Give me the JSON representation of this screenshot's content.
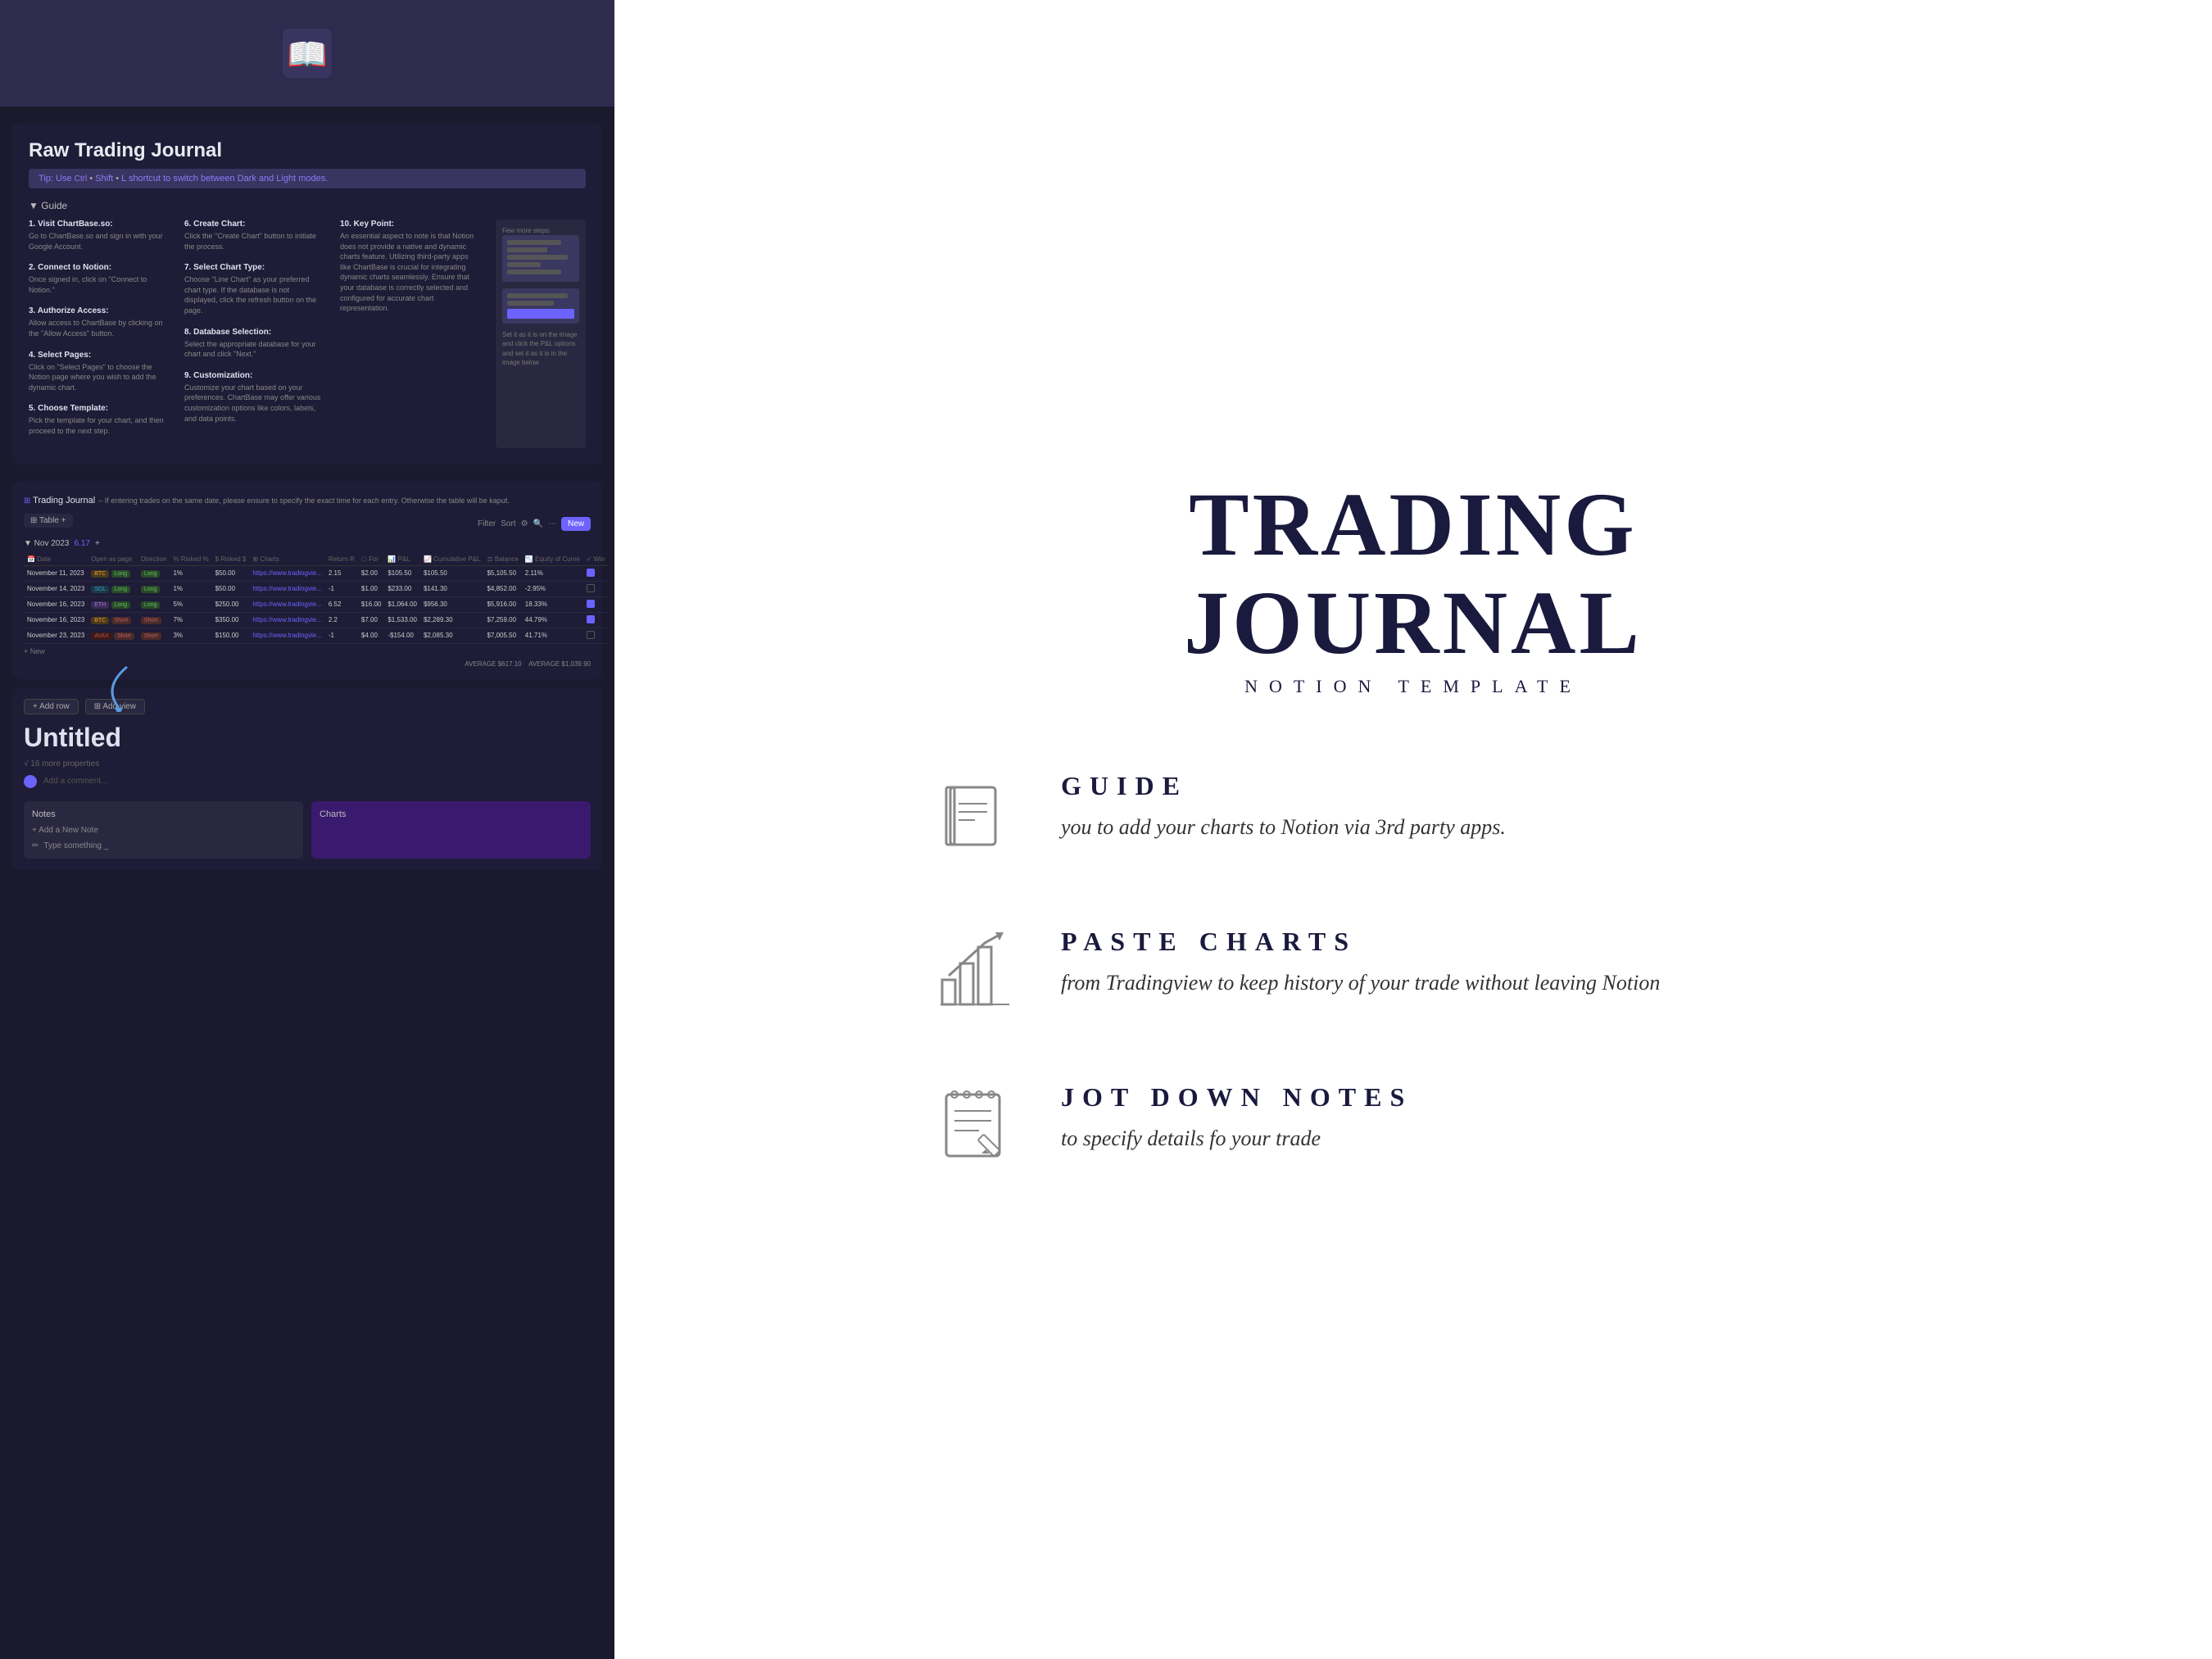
{
  "leftPanel": {
    "header": {
      "label": "header-area"
    },
    "guideSection": {
      "title": "Raw Trading Journal",
      "tipText": "Tip: Use ",
      "tipShortcut": "Ctrl + Shift + L",
      "tipEnd": " shortcut to switch between Dark and Light modes.",
      "guideLabel": "▼ Guide",
      "steps": [
        {
          "num": "1.",
          "title": "Visit ChartBase.so:",
          "text": "Go to ChartBase.so and sign in with your Google Account."
        },
        {
          "num": "2.",
          "title": "Connect to Notion:",
          "text": "Once signed in, click on \"Connect to Notion.\""
        },
        {
          "num": "3.",
          "title": "Authorize Access:",
          "text": "Allow access to ChartBase by clicking on the \"Allow Access\" button."
        },
        {
          "num": "4.",
          "title": "Select Pages:",
          "text": "Click on \"Select Pages\" to choose the Notion page where you wish to add the dynamic chart."
        },
        {
          "num": "5.",
          "title": "Choose Template:",
          "text": "Pick the template for your chart, and then proceed to the next step."
        }
      ],
      "stepsRight": [
        {
          "num": "6.",
          "title": "Create Chart:",
          "text": "Click the \"Create Chart\" button to initiate the process."
        },
        {
          "num": "7.",
          "title": "Select Chart Type:",
          "text": "Choose \"Line Chart\" as your preferred chart type. If the database is not displayed, click the refresh button on the page."
        },
        {
          "num": "8.",
          "title": "Database Selection:",
          "text": "Select the appropriate database for your chart and click \"Next.\""
        },
        {
          "num": "9.",
          "title": "Customization:",
          "text": "Customize your chart based on your preferences. ChartBase may offer various customization options like colors, labels, and data points."
        }
      ],
      "stepsMore": [
        {
          "num": "10.",
          "title": "Key Point:",
          "text": "An essential aspect to note is that Notion does not provide a native and dynamic charts feature. Utilizing third-party apps like ChartBase is crucial for integrating dynamic charts seamlessly. Ensure that your database is correctly selected and configured for accurate chart representation."
        }
      ],
      "fewMoreSteps": "Few more steps:",
      "screenshotCaption": "Set it as it is on the image and click the P&L options and set it as it is in the image below"
    },
    "tableSection": {
      "title": "Trading Journal",
      "subtitle": "If entering trades on the same date, please ensure to specify the exact time for each entry. Otherwise the table will be kaput.",
      "viewLabel": "⊞ Table  +",
      "monthLabel": "▼ Nov 2023",
      "count": "6.17",
      "filterLabel": "Filter",
      "sortLabel": "Sort",
      "newLabel": "New",
      "columns": [
        "Date",
        "Open as page",
        "Direction",
        "% Risked %",
        "$ Risked $",
        "Charts",
        "Return R",
        "For",
        "P&L",
        "Cumulative P&L",
        "Balance",
        "Equity of Curve",
        "Win"
      ],
      "rows": [
        {
          "date": "November 11, 2023",
          "coin": "BTC",
          "direction": "Long",
          "riskedPct": "1%",
          "riskedDollar": "$50.00",
          "charts": "https://www.tradingvie...",
          "returnR": "2.15",
          "for": "$2.00",
          "pnl": "$105.50",
          "cumPnl": "$105.50",
          "balance": "$5,105.50",
          "equity": "2.11%",
          "win": true
        },
        {
          "date": "November 14, 2023",
          "coin": "SOL",
          "direction": "Long",
          "riskedPct": "1%",
          "riskedDollar": "$50.00",
          "charts": "https://www.tradingvie...",
          "returnR": "-1",
          "for": "$1.00",
          "pnl": "$233.00",
          "cumPnl": "$141.30",
          "balance": "$4,852.00",
          "equity": "-2.95%",
          "win": false
        },
        {
          "date": "November 16, 2023",
          "coin": "ETH",
          "direction": "Long",
          "riskedPct": "5%",
          "riskedDollar": "$250.00",
          "charts": "https://www.tradingvie...",
          "returnR": "6.52",
          "for": "$16.00",
          "pnl": "$1,064.00",
          "cumPnl": "$956.30",
          "balance": "$5,916.00",
          "equity": "18.33%",
          "win": true
        },
        {
          "date": "November 16, 2023",
          "coin": "BTC",
          "direction": "Short",
          "riskedPct": "7%",
          "riskedDollar": "$350.00",
          "charts": "https://www.tradingvie...",
          "returnR": "2.2",
          "for": "$7.00",
          "pnl": "$1,533.00",
          "cumPnl": "$2,289.30",
          "balance": "$7,259.00",
          "equity": "44.79%",
          "win": true
        },
        {
          "date": "November 23, 2023",
          "coin": "AVAX",
          "direction": "Short",
          "riskedPct": "3%",
          "riskedDollar": "$150.00",
          "charts": "https://www.tradingvie...",
          "returnR": "-1",
          "for": "$4.00",
          "pnl": "-$154.00",
          "cumPnl": "$2,085.30",
          "balance": "$7,005.50",
          "equity": "41.71%",
          "win": false
        }
      ],
      "avgLabel": "AVERAGE $617.10",
      "avgCumLabel": "AVERAGE $1,039.90"
    },
    "entrySection": {
      "addRowBtn": "+ Add row",
      "editBtn": "⊞ Add view",
      "titlePlaceholder": "Untitled",
      "propertiesLabel": "√ 16 more properties",
      "commentPlaceholder": "Add a comment...",
      "notesHeader": "Notes",
      "chartsHeader": "Charts",
      "addNoteLabel": "+ Add a New Note",
      "noteInputPlaceholder": "Type something _",
      "noteInputLabel": "Notes"
    }
  },
  "rightPanel": {
    "brandTitle1": "TRADING",
    "brandTitle2": "JOURNAL",
    "brandSubtitle": "NOTION TEMPLATE",
    "features": [
      {
        "id": "guide",
        "icon": "book",
        "label": "GUIDE",
        "description": "you to add your charts to Notion via 3rd party apps."
      },
      {
        "id": "paste-charts",
        "icon": "chart",
        "label": "PASTE CHARTS",
        "description": "from Tradingview to keep history of your trade without leaving Notion"
      },
      {
        "id": "jot-notes",
        "icon": "notes",
        "label": "JOT DOWN NOTES",
        "description": "to specify details fo your trade"
      }
    ]
  }
}
